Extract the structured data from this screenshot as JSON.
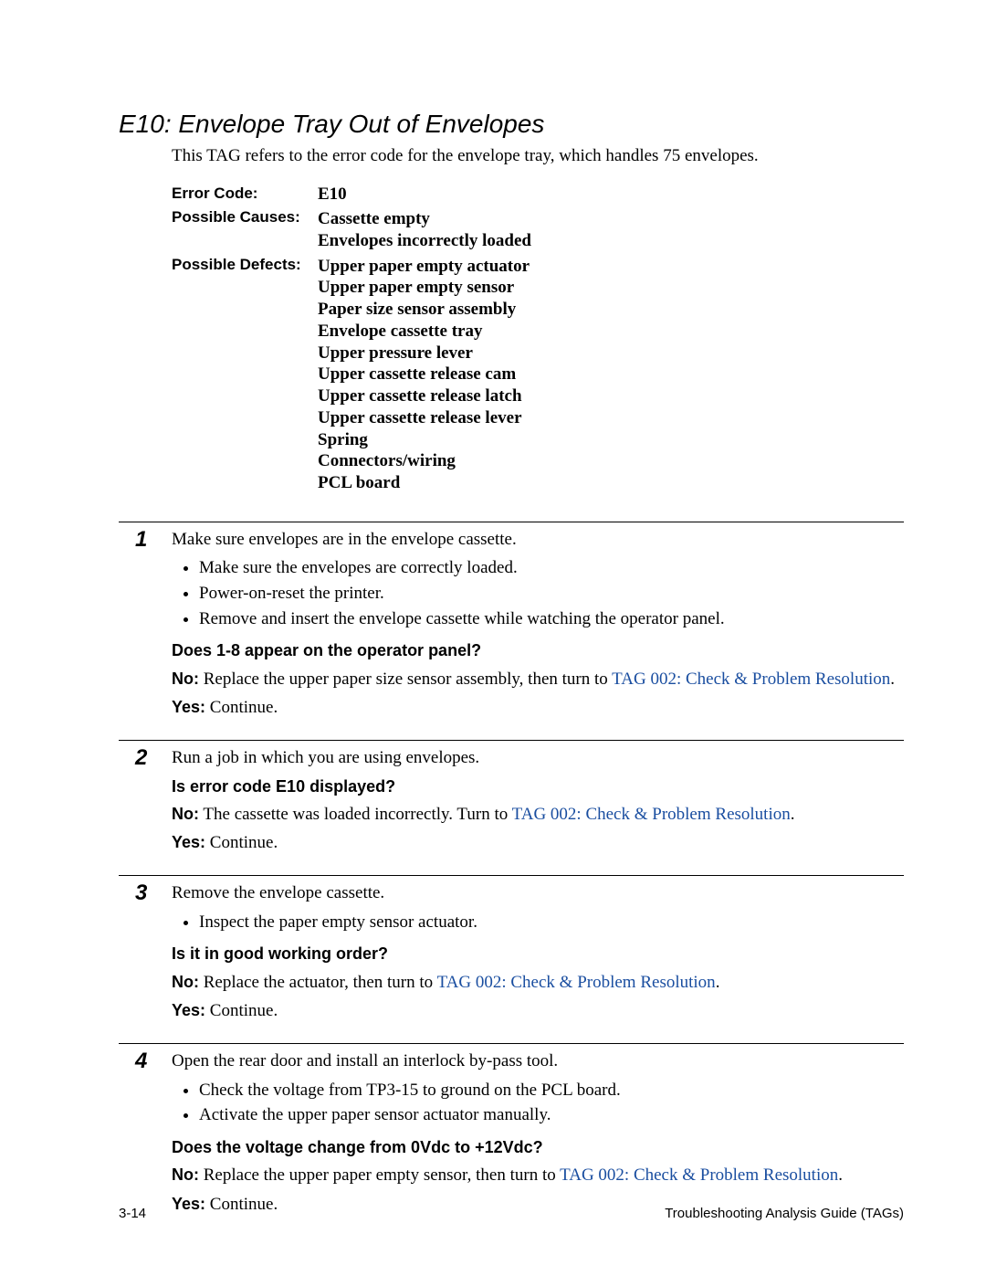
{
  "title": "E10: Envelope Tray Out of Envelopes",
  "intro": "This TAG refers to the error code for the envelope tray, which handles 75 envelopes.",
  "info": {
    "error_code_label": "Error Code:",
    "error_code_value": "E10",
    "possible_causes_label": "Possible Causes:",
    "possible_causes": [
      "Cassette empty",
      "Envelopes incorrectly loaded"
    ],
    "possible_defects_label": "Possible Defects:",
    "possible_defects": [
      "Upper paper empty actuator",
      "Upper paper empty sensor",
      "Paper size sensor assembly",
      "Envelope cassette tray",
      "Upper pressure lever",
      "Upper cassette release cam",
      "Upper cassette release latch",
      "Upper cassette release lever",
      "Spring",
      "Connectors/wiring",
      "PCL board"
    ]
  },
  "steps": [
    {
      "num": "1",
      "lead": "Make sure envelopes are in the envelope cassette.",
      "bullets": [
        "Make sure the envelopes are correctly loaded.",
        "Power-on-reset the printer.",
        "Remove and insert the envelope cassette while watching the operator panel."
      ],
      "question": "Does 1-8 appear on the operator panel?",
      "no_pre": "Replace the upper paper size sensor assembly, then turn to ",
      "no_link": "TAG 002: Check & Problem Resolution",
      "no_post": ".",
      "yes": "Continue."
    },
    {
      "num": "2",
      "lead": "Run a job in which you are using envelopes.",
      "bullets": [],
      "question": "Is error code E10 displayed?",
      "no_pre": "The cassette was loaded incorrectly. Turn to ",
      "no_link": "TAG 002: Check & Problem Resolution",
      "no_post": ".",
      "yes": "Continue."
    },
    {
      "num": "3",
      "lead": "Remove the envelope cassette.",
      "bullets": [
        "Inspect the paper empty sensor actuator."
      ],
      "question": "Is it in good working order?",
      "no_pre": "Replace the actuator, then turn to ",
      "no_link": "TAG 002: Check & Problem Resolution",
      "no_post": ".",
      "yes": "Continue."
    },
    {
      "num": "4",
      "lead": "Open the rear door and install an interlock by-pass tool.",
      "bullets": [
        "Check the voltage from TP3-15 to ground on the PCL board.",
        "Activate the upper paper sensor actuator manually."
      ],
      "question": "Does the voltage change from 0Vdc to +12Vdc?",
      "no_pre": "Replace the upper paper empty sensor, then turn to ",
      "no_link": "TAG 002: Check & Problem Resolution",
      "no_post": ".",
      "yes": "Continue."
    }
  ],
  "labels": {
    "no": "No:",
    "yes": "Yes:"
  },
  "footer": {
    "left": "3-14",
    "right": "Troubleshooting Analysis Guide (TAGs)"
  }
}
